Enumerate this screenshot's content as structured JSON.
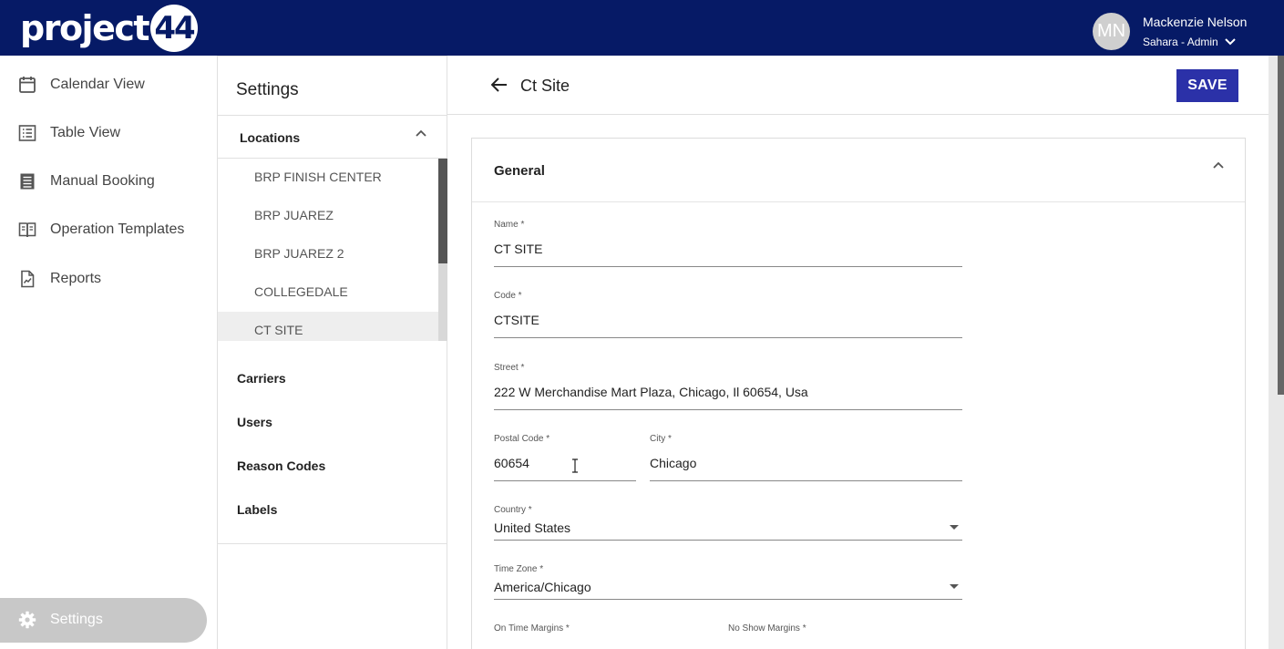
{
  "header": {
    "logo_text": "project",
    "logo_num": "44",
    "avatar_initials": "MN",
    "user_name": "Mackenzie Nelson",
    "user_role": "Sahara - Admin"
  },
  "nav": {
    "items": [
      {
        "label": "Calendar View",
        "icon": "calendar-icon"
      },
      {
        "label": "Table View",
        "icon": "table-list-icon"
      },
      {
        "label": "Manual Booking",
        "icon": "booking-icon"
      },
      {
        "label": "Operation Templates",
        "icon": "book-icon"
      },
      {
        "label": "Reports",
        "icon": "report-icon"
      }
    ],
    "settings_label": "Settings"
  },
  "settings": {
    "title": "Settings",
    "locations_label": "Locations",
    "locations": [
      "BRP FINISH CENTER",
      "BRP JUAREZ",
      "BRP JUAREZ 2",
      "COLLEGEDALE",
      "CT SITE"
    ],
    "active_location": "CT SITE",
    "sections": [
      "Carriers",
      "Users",
      "Reason Codes",
      "Labels"
    ]
  },
  "main": {
    "title": "Ct Site",
    "save_label": "SAVE",
    "card_title": "General",
    "fields": {
      "name": {
        "label": "Name *",
        "value": "CT SITE"
      },
      "code": {
        "label": "Code *",
        "value": "CTSITE"
      },
      "street": {
        "label": "Street *",
        "value": "222 W Merchandise Mart Plaza, Chicago, Il 60654, Usa"
      },
      "postal": {
        "label": "Postal Code *",
        "value": "60654"
      },
      "city": {
        "label": "City *",
        "value": "Chicago"
      },
      "country": {
        "label": "Country *",
        "value": "United States"
      },
      "timezone": {
        "label": "Time Zone *",
        "value": "America/Chicago"
      },
      "ontime": {
        "label": "On Time Margins *"
      },
      "noshow": {
        "label": "No Show Margins *"
      }
    }
  },
  "colors": {
    "header_bg": "#061a66",
    "save_button": "#2b31a8",
    "active_nav": "#c8c8c8"
  }
}
